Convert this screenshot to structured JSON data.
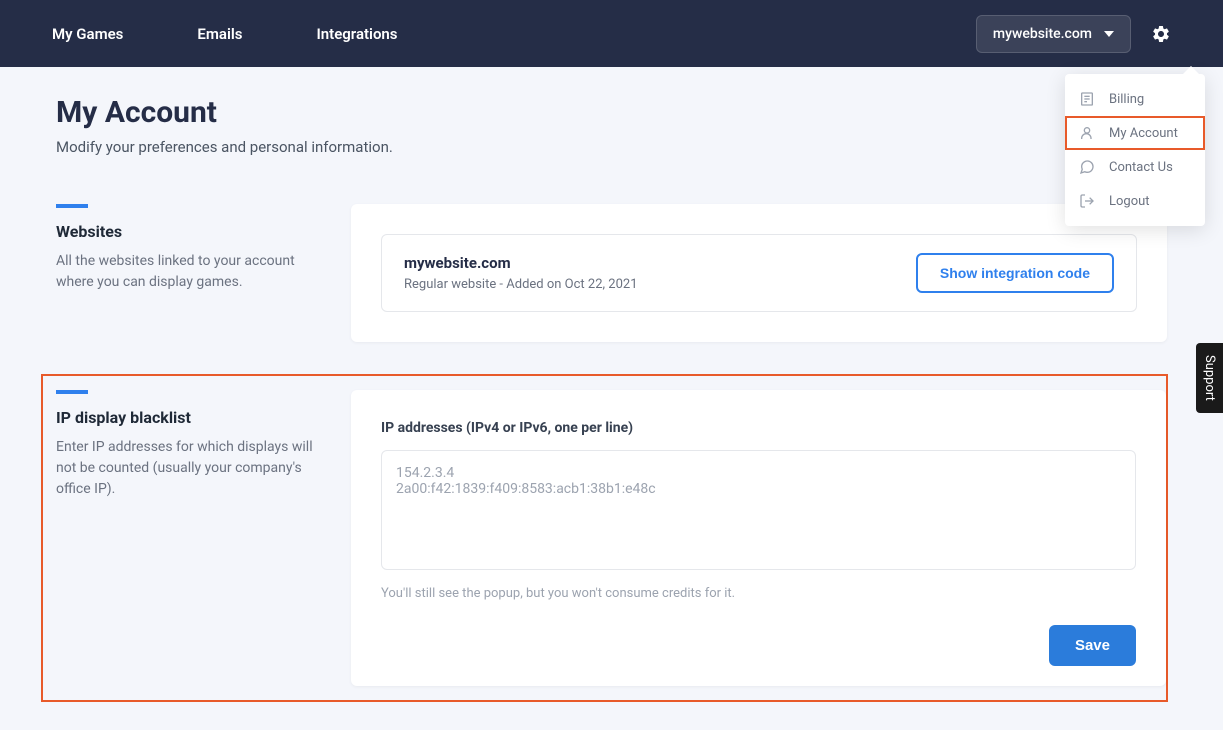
{
  "header": {
    "nav": [
      {
        "label": "My Games"
      },
      {
        "label": "Emails"
      },
      {
        "label": "Integrations"
      }
    ],
    "site_selector": {
      "selected": "mywebsite.com"
    }
  },
  "dropdown": {
    "items": [
      {
        "label": "Billing",
        "icon": "billing-icon",
        "highlighted": false
      },
      {
        "label": "My Account",
        "icon": "user-icon",
        "highlighted": true
      },
      {
        "label": "Contact Us",
        "icon": "chat-icon",
        "highlighted": false
      },
      {
        "label": "Logout",
        "icon": "logout-icon",
        "highlighted": false
      }
    ]
  },
  "page": {
    "title": "My Account",
    "subtitle": "Modify your preferences and personal information."
  },
  "websites_section": {
    "title": "Websites",
    "description": "All the websites linked to your account where you can display games.",
    "card": {
      "name": "mywebsite.com",
      "meta": "Regular website - Added on Oct 22, 2021",
      "button_label": "Show integration code"
    }
  },
  "ip_section": {
    "title": "IP display blacklist",
    "description": "Enter IP addresses for which displays will not be counted (usually your company's office IP).",
    "field_label": "IP addresses (IPv4 or IPv6, one per line)",
    "placeholder": "154.2.3.4\n2a00:f42:1839:f409:8583:acb1:38b1:e48c",
    "value": "",
    "helper": "You'll still see the popup, but you won't consume credits for it.",
    "save_label": "Save"
  },
  "support_tab": {
    "label": "Support"
  }
}
